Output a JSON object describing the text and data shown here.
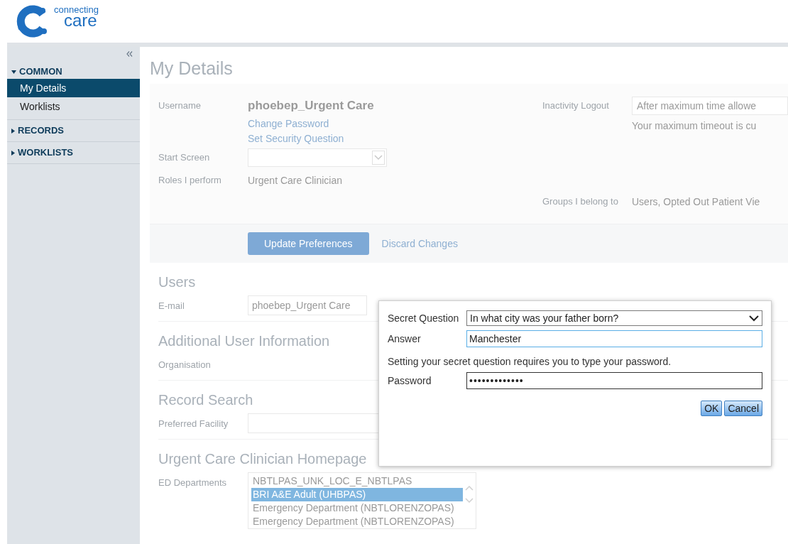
{
  "logo": {
    "line_1": "connecting",
    "line_2": "care"
  },
  "sidebar": {
    "groups": [
      {
        "label": "COMMON",
        "expanded": true,
        "items": [
          {
            "label": "My Details",
            "selected": true
          },
          {
            "label": "Worklists",
            "selected": false
          }
        ]
      },
      {
        "label": "RECORDS",
        "expanded": false
      },
      {
        "label": "WORKLISTS",
        "expanded": false
      }
    ]
  },
  "page_title": "My Details",
  "preferences": {
    "username": {
      "label": "Username",
      "value": "phoebep_Urgent Care"
    },
    "links": [
      "Change Password",
      "Set Security Question"
    ],
    "start_screen": {
      "label": "Start Screen"
    },
    "roles": {
      "label": "Roles I perform",
      "value": "Urgent Care Clinician"
    },
    "inactivity_logout": {
      "label": "Inactivity Logout",
      "value": "After maximum time allowe",
      "note": "Your maximum timeout is cu"
    },
    "groups": {
      "label": "Groups I belong to",
      "value": "Users, Opted Out Patient Vie"
    },
    "buttons": {
      "primary": "Update Preferences",
      "secondary": "Discard Changes"
    }
  },
  "sections": [
    {
      "title": "Users",
      "fields": [
        {
          "label": "E-mail",
          "kind": "input",
          "value": "phoebep_Urgent Care"
        }
      ]
    },
    {
      "title": "Additional User Information",
      "fields": [
        {
          "label": "Organisation",
          "kind": "plain"
        }
      ]
    },
    {
      "title": "Record Search",
      "fields": [
        {
          "label": "Preferred Facility",
          "kind": "input"
        }
      ]
    },
    {
      "title": "Urgent Care Clinician Homepage",
      "fields": [
        {
          "label": "ED Departments",
          "kind": "listbox",
          "options": [
            {
              "label": "NBTLPAS_UNK_LOC_E_NBTLPAS",
              "selected": false
            },
            {
              "label": "BRI A&E Adult (UHBPAS)",
              "selected": true
            },
            {
              "label": "Emergency Department (NBTLORENZOPAS)",
              "selected": false
            },
            {
              "label": "Emergency Department (NBTLORENZOPAS)",
              "selected": false
            }
          ]
        }
      ]
    }
  ],
  "dialog": {
    "question": {
      "label": "Secret Question",
      "value": "In what city was your father born?"
    },
    "answer": {
      "label": "Answer",
      "value": "Manchester"
    },
    "note": "Setting your secret question requires you to type your password.",
    "password": {
      "label": "Password",
      "value": "•••••••••••••"
    },
    "buttons": [
      "OK",
      "Cancel"
    ]
  }
}
